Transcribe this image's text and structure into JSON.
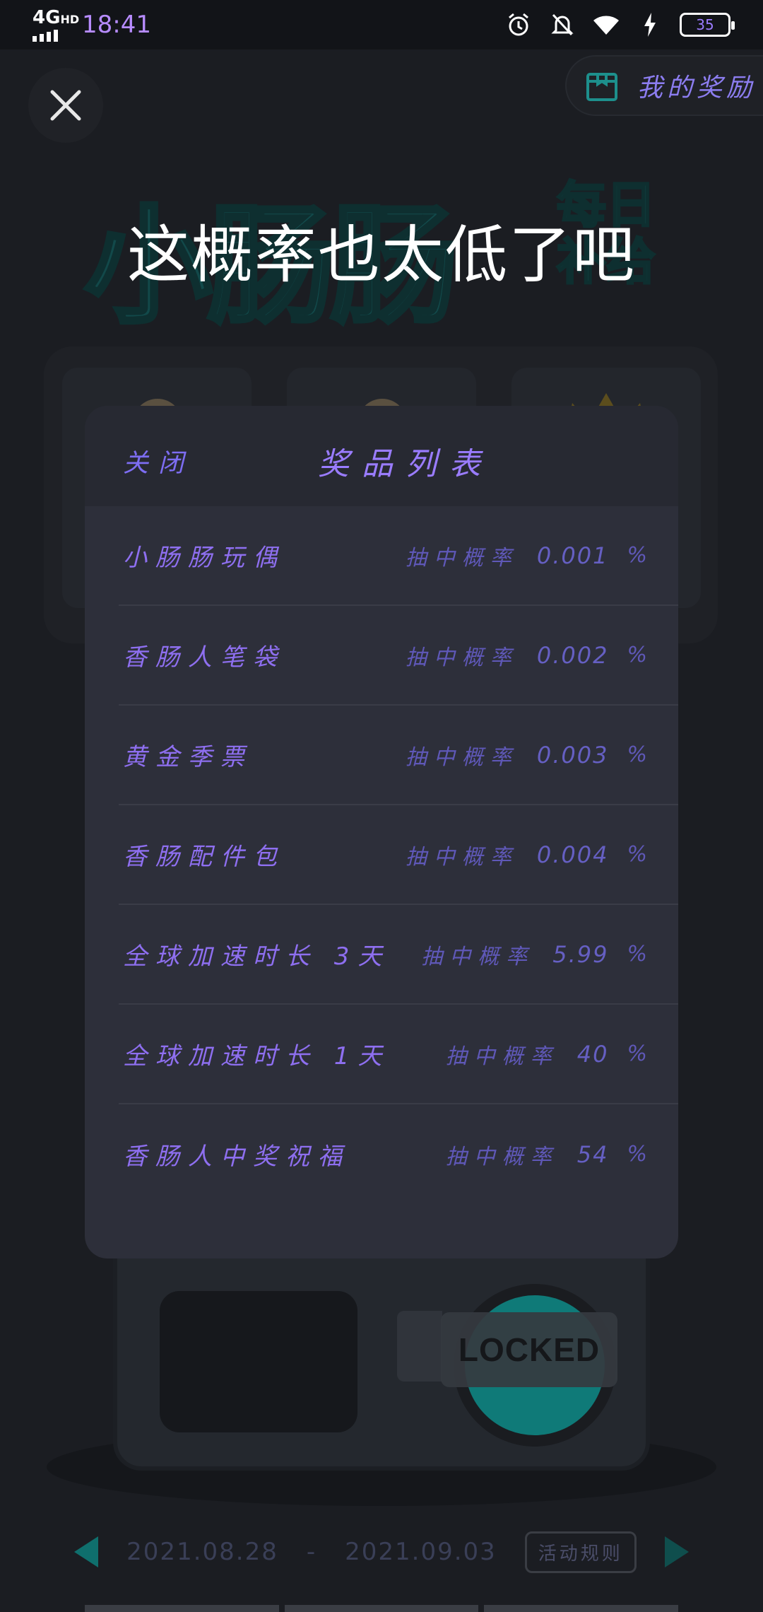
{
  "status_bar": {
    "network": "4G",
    "network_suffix": "HD",
    "time": "18:41",
    "battery": "35"
  },
  "header": {
    "my_rewards_label": "我的奖励"
  },
  "banner": {
    "title_big": "小肠肠",
    "title_small_1": "每日",
    "title_small_2": "补给"
  },
  "caption": "这概率也太低了吧",
  "machine": {
    "locked_label": "LOCKED"
  },
  "footer": {
    "date_start": "2021.08.28",
    "date_sep": "-",
    "date_end": "2021.09.03",
    "rules_label": "活动规则"
  },
  "modal": {
    "close_label": "关闭",
    "title": "奖品列表",
    "prob_label": "抽中概率",
    "percent_sign": "%",
    "prizes": [
      {
        "name": "小肠肠玩偶",
        "prob": "0.001"
      },
      {
        "name": "香肠人笔袋",
        "prob": "0.002"
      },
      {
        "name": "黄金季票",
        "prob": "0.003"
      },
      {
        "name": "香肠配件包",
        "prob": "0.004"
      },
      {
        "name": "全球加速时长 3天",
        "prob": "5.99"
      },
      {
        "name": "全球加速时长 1天",
        "prob": "40"
      },
      {
        "name": "香肠人中奖祝福",
        "prob": "54"
      }
    ]
  },
  "colors": {
    "accent_purple": "#9a7cff",
    "teal": "#0f7a78",
    "modal_bg": "#2d2f3a"
  }
}
